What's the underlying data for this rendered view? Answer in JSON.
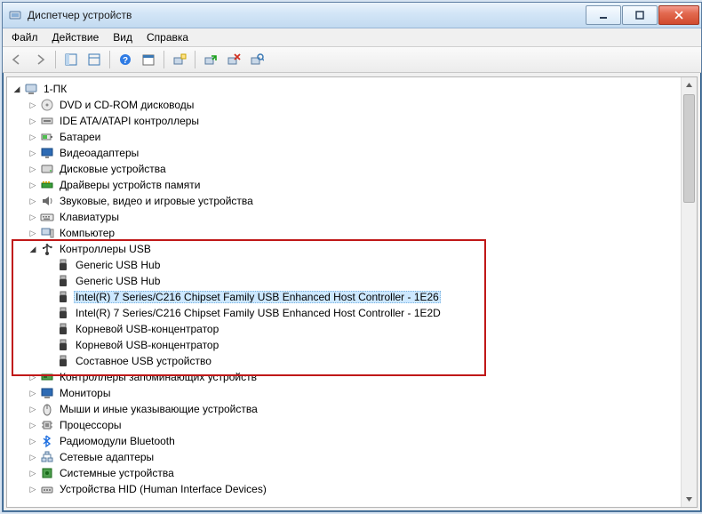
{
  "window": {
    "title": "Диспетчер устройств"
  },
  "menu": {
    "file": "Файл",
    "action": "Действие",
    "view": "Вид",
    "help": "Справка"
  },
  "tree": {
    "root": {
      "label": "1-ПК",
      "expanded": true
    },
    "categories": [
      {
        "label": "DVD и CD-ROM дисководы",
        "icon": "disc",
        "expanded": false,
        "children": []
      },
      {
        "label": "IDE ATA/ATAPI контроллеры",
        "icon": "ide",
        "expanded": false,
        "children": []
      },
      {
        "label": "Батареи",
        "icon": "battery",
        "expanded": false,
        "children": []
      },
      {
        "label": "Видеоадаптеры",
        "icon": "display",
        "expanded": false,
        "children": []
      },
      {
        "label": "Дисковые устройства",
        "icon": "hdd",
        "expanded": false,
        "children": []
      },
      {
        "label": "Драйверы устройств памяти",
        "icon": "memdrv",
        "expanded": false,
        "children": []
      },
      {
        "label": "Звуковые, видео и игровые устройства",
        "icon": "audio",
        "expanded": false,
        "children": []
      },
      {
        "label": "Клавиатуры",
        "icon": "keyboard",
        "expanded": false,
        "children": []
      },
      {
        "label": "Компьютер",
        "icon": "computer",
        "expanded": false,
        "children": []
      },
      {
        "label": "Контроллеры USB",
        "icon": "usb",
        "expanded": true,
        "highlight": true,
        "children": [
          {
            "label": "Generic USB Hub",
            "icon": "usbdev"
          },
          {
            "label": "Generic USB Hub",
            "icon": "usbdev"
          },
          {
            "label": "Intel(R) 7 Series/C216 Chipset Family USB Enhanced Host Controller - 1E26",
            "icon": "usbdev",
            "selected": true
          },
          {
            "label": "Intel(R) 7 Series/C216 Chipset Family USB Enhanced Host Controller - 1E2D",
            "icon": "usbdev"
          },
          {
            "label": "Корневой USB-концентратор",
            "icon": "usbdev"
          },
          {
            "label": "Корневой USB-концентратор",
            "icon": "usbdev"
          },
          {
            "label": "Составное USB устройство",
            "icon": "usbdev"
          }
        ]
      },
      {
        "label": "Контроллеры запоминающих устройств",
        "icon": "storage",
        "expanded": false,
        "children": []
      },
      {
        "label": "Мониторы",
        "icon": "monitor",
        "expanded": false,
        "children": []
      },
      {
        "label": "Мыши и иные указывающие устройства",
        "icon": "mouse",
        "expanded": false,
        "children": []
      },
      {
        "label": "Процессоры",
        "icon": "cpu",
        "expanded": false,
        "children": []
      },
      {
        "label": "Радиомодули Bluetooth",
        "icon": "bluetooth",
        "expanded": false,
        "children": []
      },
      {
        "label": "Сетевые адаптеры",
        "icon": "network",
        "expanded": false,
        "children": []
      },
      {
        "label": "Системные устройства",
        "icon": "system",
        "expanded": false,
        "children": []
      },
      {
        "label": "Устройства HID (Human Interface Devices)",
        "icon": "hid",
        "expanded": false,
        "children": []
      }
    ]
  }
}
